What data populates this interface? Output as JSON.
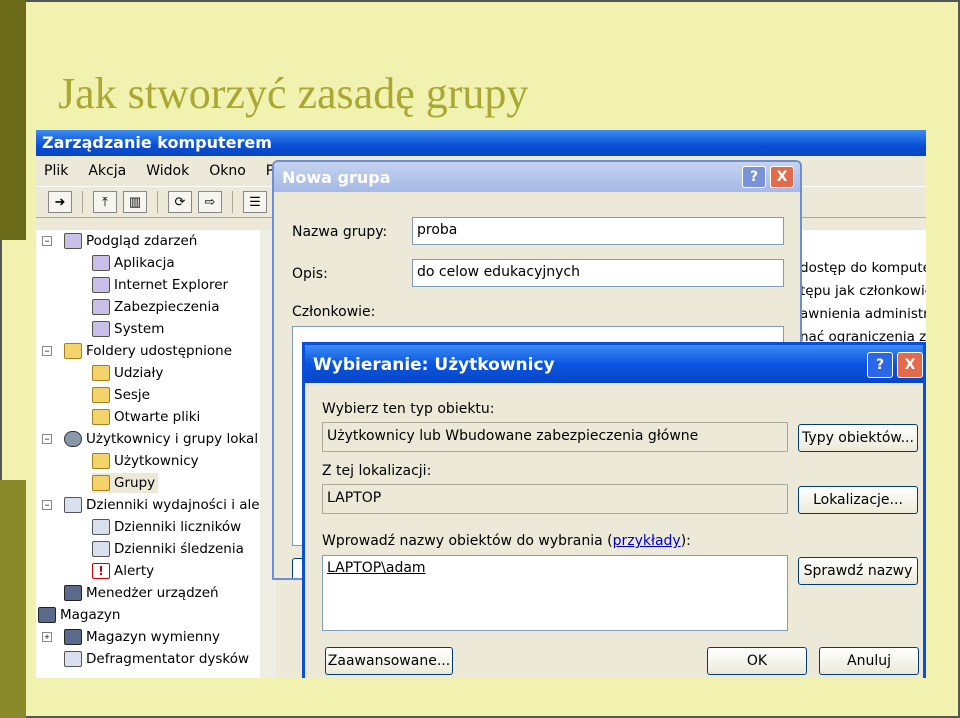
{
  "slide": {
    "title": "Jak stworzyć zasadę grupy"
  },
  "mmc": {
    "title": "Zarządzanie komputerem",
    "menu": [
      "Plik",
      "Akcja",
      "Widok",
      "Okno",
      "P"
    ],
    "tree": [
      "Podgląd zdarzeń",
      "Aplikacja",
      "Internet Explorer",
      "Zabezpieczenia",
      "System",
      "Foldery udostępnione",
      "Udziały",
      "Sesje",
      "Otwarte pliki",
      "Użytkownicy i grupy lokal",
      "Użytkownicy",
      "Grupy",
      "Dzienniki wydajności i alei",
      "Dzienniki liczników",
      "Dzienniki śledzenia",
      "Alerty",
      "Menedżer urządzeń",
      "Magazyn",
      "Magazyn wymienny",
      "Defragmentator dysków"
    ],
    "right_lines": [
      "dostęp do kompute",
      "tępu jak członkowie",
      "awnienia administra",
      "nać ograniczenia za"
    ]
  },
  "nowa_grupa": {
    "title": "Nowa grupa",
    "name_label": "Nazwa grupy:",
    "name_value": "proba",
    "desc_label": "Opis:",
    "desc_value": "do celow edukacyjnych",
    "members_label": "Członkowie:"
  },
  "wybieranie": {
    "title": "Wybieranie: Użytkownicy",
    "type_label": "Wybierz ten typ obiektu:",
    "type_value": "Użytkownicy lub Wbudowane zabezpieczenia główne",
    "type_button": "Typy obiektów...",
    "loc_label": "Z tej lokalizacji:",
    "loc_value": "LAPTOP",
    "loc_button": "Lokalizacje...",
    "names_label": "Wprowadź nazwy obiektów do wybrania (",
    "names_link": "przykłady",
    "names_label_end": "):",
    "names_value": "LAPTOP\\adam",
    "check_button": "Sprawdź nazwy",
    "advanced_button": "Zaawansowane...",
    "ok_button": "OK",
    "cancel_button": "Anuluj"
  },
  "captions": {
    "help": "?",
    "close": "X"
  },
  "colors": {
    "xp_blue": "#0a4fd6",
    "dialog_bg": "#ece9d8",
    "slide_bg": "#f2f2b0"
  }
}
